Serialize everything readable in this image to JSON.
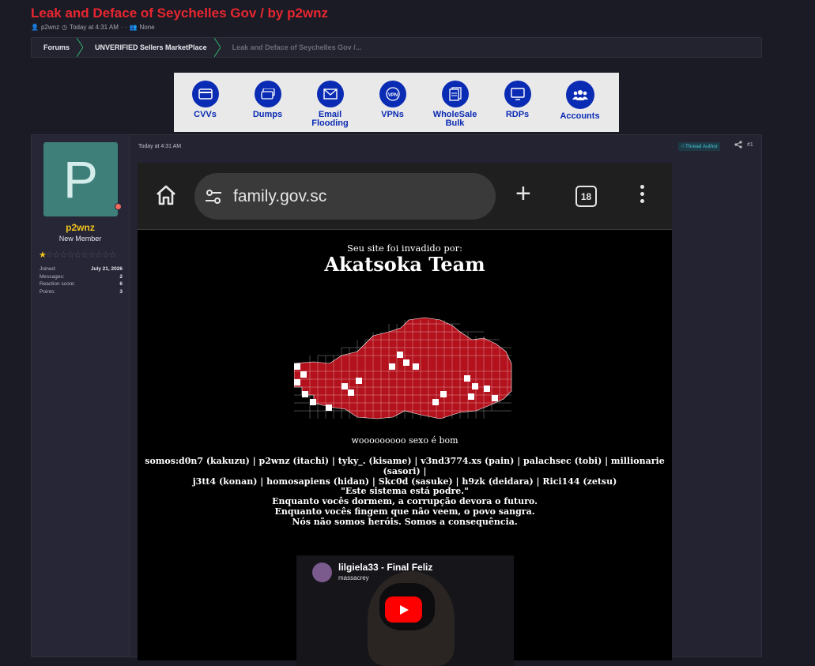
{
  "thread": {
    "title": "Leak and Deface of Seychelles Gov / by p2wnz",
    "author": "p2wnz",
    "time": "Today at 4:31 AM",
    "extra": "· ·",
    "audience": "None"
  },
  "breadcrumb": {
    "items": [
      "Forums",
      "UNVERIFIED Sellers MarketPlace",
      "Leak and Deface of Seychelles Gov /..."
    ]
  },
  "banner": {
    "items": [
      {
        "label": "CVVs",
        "icon": "credit-card-icon"
      },
      {
        "label": "Dumps",
        "icon": "card-stack-icon"
      },
      {
        "label": "Email\nFlooding",
        "icon": "envelope-icon"
      },
      {
        "label": "VPNs",
        "icon": "vpn-shield-icon"
      },
      {
        "label": "WholeSale\nBulk",
        "icon": "documents-icon"
      },
      {
        "label": "RDPs",
        "icon": "monitor-icon"
      },
      {
        "label": "Accounts",
        "icon": "users-icon"
      }
    ],
    "accent": "#0a2bb3"
  },
  "user": {
    "avatar_letter": "P",
    "name": "p2wnz",
    "title": "New Member",
    "stats": [
      {
        "label": "Joined:",
        "value": "July 21, 2026"
      },
      {
        "label": "Messages:",
        "value": "2"
      },
      {
        "label": "Reaction score:",
        "value": "6"
      },
      {
        "label": "Points:",
        "value": "3"
      }
    ],
    "rating_stars": 0.5
  },
  "post": {
    "time": "Today at 4:31 AM",
    "badge": "Thread Author",
    "number": "#1"
  },
  "screenshot": {
    "url": "family.gov.sc",
    "tab_count": "18",
    "invaded_by": "Seu site foi invadido por:",
    "team": "Akatsoka Team",
    "woo": "wooooooooo sexo é bom",
    "somos_1": "somos:d0n7 (kakuzu) | p2wnz (itachi) | tyky_. (kisame) | v3nd3774.xs (pain) | palachsec (tobi) | millionarie (sasori) |",
    "somos_2": "j3tt4 (konan) | homosapiens (hidan) | Skc0d (sasuke) | h9zk (deidara) | Rici144 (zetsu)",
    "quote_1": "\"Este sistema está podre.\"",
    "quote_2": "Enquanto vocês dormem, a corrupção devora o futuro.",
    "quote_3": "Enquanto vocês fingem que não veem, o povo sangra.",
    "quote_4": "Nós não somos heróis. Somos a consequência.",
    "video_title": "lilgiela33 - Final Feliz",
    "video_channel": "massacrey"
  }
}
